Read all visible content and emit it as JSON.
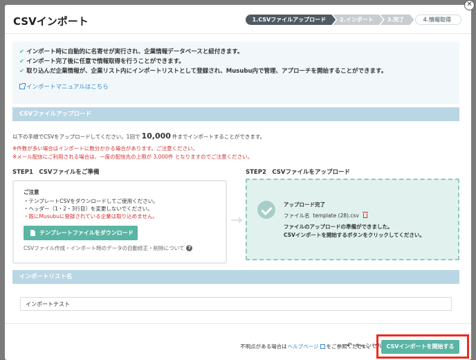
{
  "header": {
    "title": "CSVインポート",
    "steps": [
      "1.CSVファイルアップロード",
      "2.インポート",
      "3.完了",
      "4.情報取得"
    ]
  },
  "info": {
    "items": [
      "インポート時に自動的に名寄せが実行され、企業情報データベースと紐付きます。",
      "インポート完了後に任意で情報取得を行うことができます。",
      "取り込んだ企業情報が、企業リスト内にインポートリストとして登録され、Musubu内で管理、アプローチを開始することができます。"
    ],
    "manual_link": "インポートマニュアルはこちら"
  },
  "upload_section": {
    "title": "CSVファイルアップロード",
    "desc_pre": "以下の手順でCSVをアップロードしてください。1回で",
    "desc_count": "10,000",
    "desc_post": "件までインポートすることができます。",
    "warn1": "※件数が多い場合はインポートに数分かかる場合があります。ご注意ください。",
    "warn2": "※メール配信にご利用される場合は、一度の配信先の上限が 3,000件 となりますのでご注意ください。",
    "step1_label": "STEP1　CSVファイルをご準備",
    "step1": {
      "note_title": "ご注意",
      "notes": [
        "・テンプレートCSVをダウンロードしてご使用ください。",
        "・ヘッダー（1・2・3行目）を変更しないでください。",
        "・既にMusubuに登録されている企業は取り込めません。"
      ],
      "download_label": "テンプレートファイルをダウンロード",
      "auto_note": "CSVファイル作成・インポート時のデータの自動修正・削除について"
    },
    "step2_label": "STEP2　CSVファイルをアップロード",
    "step2": {
      "status": "アップロード完了",
      "file_label": "ファイル名",
      "file_name": "template (28).csv",
      "msg1": "ファイルのアップロードの準備ができました。",
      "msg2": "CSVインポートを開始するボタンをクリックしてください。"
    }
  },
  "list_section": {
    "title": "インポートリスト名",
    "input_value": "インポートテスト"
  },
  "footer": {
    "help_pre": "不明点がある場合は",
    "help_link": "ヘルプページ",
    "help_post": "をご参照ください。",
    "cancel_label": "キャンセル",
    "submit_label": "CSVインポートを開始する"
  },
  "colors": {
    "accent": "#5ab5a5",
    "section_bar": "#b9d6e4",
    "warning": "#d62e2e",
    "highlight": "#ee2a1e"
  }
}
